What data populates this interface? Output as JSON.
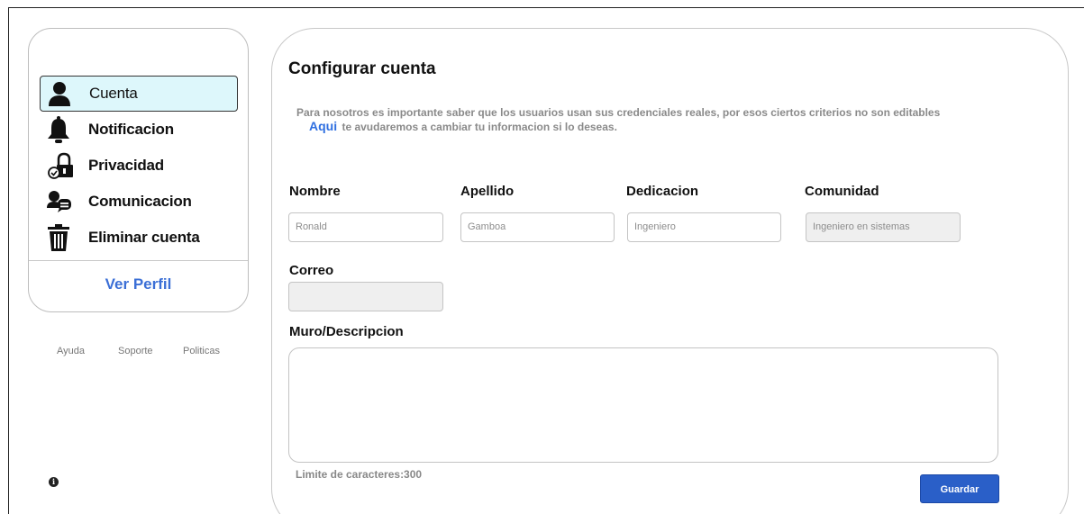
{
  "sidebar": {
    "items": [
      {
        "label": "Cuenta",
        "icon": "user-icon",
        "active": true
      },
      {
        "label": "Notificacion",
        "icon": "bell-icon"
      },
      {
        "label": "Privacidad",
        "icon": "lock-icon"
      },
      {
        "label": "Comunicacion",
        "icon": "chat-icon"
      },
      {
        "label": "Eliminar cuenta",
        "icon": "trash-icon"
      }
    ],
    "profile_link": "Ver Perfil"
  },
  "footer": {
    "links": [
      "Ayuda",
      "Soporte",
      "Politicas"
    ]
  },
  "main": {
    "title": "Configurar cuenta",
    "description": "Para nosotros es importante saber que los usuarios usan sus credenciales reales, por esos ciertos criterios no son editables",
    "help_link": "Aqui",
    "help_text": "te avudaremos a cambiar tu informacion si lo deseas.",
    "fields": {
      "nombre": {
        "label": "Nombre",
        "value": "Ronald"
      },
      "apellido": {
        "label": "Apellido",
        "value": "Gamboa"
      },
      "dedicacion": {
        "label": "Dedicacion",
        "value": "Ingeniero"
      },
      "comunidad": {
        "label": "Comunidad",
        "value": "Ingeniero en sistemas"
      },
      "correo": {
        "label": "Correo",
        "value": ""
      },
      "muro": {
        "label": "Muro/Descripcion",
        "value": ""
      }
    },
    "char_limit": "Limite de caracteres:300",
    "save_label": "Guardar"
  },
  "colors": {
    "accent": "#2a5fc8",
    "link": "#3b6fd6",
    "active_bg": "#ddf7fb"
  }
}
